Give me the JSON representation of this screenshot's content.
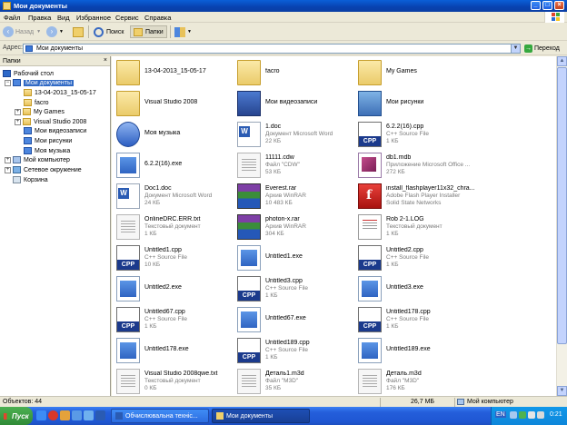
{
  "window": {
    "title": "Мои документы"
  },
  "menu": [
    "Файл",
    "Правка",
    "Вид",
    "Избранное",
    "Сервис",
    "Справка"
  ],
  "toolbar": {
    "back": "Назад",
    "search": "Поиск",
    "folders": "Папки"
  },
  "address": {
    "label": "Адрес:",
    "value": "Мои документы",
    "go": "Переход"
  },
  "folders_pane": {
    "title": "Папки",
    "close": "×",
    "tree": [
      {
        "label": "Рабочий стол",
        "icon": "desktop-icon"
      },
      {
        "label": "Мои документы",
        "icon": "my-documents-icon"
      },
      {
        "label": "13-04-2013_15-05-17",
        "icon": "folder-icon"
      },
      {
        "label": "facro",
        "icon": "folder-icon"
      },
      {
        "label": "My Games",
        "icon": "folder-icon"
      },
      {
        "label": "Visual Studio 2008",
        "icon": "folder-icon"
      },
      {
        "label": "Мои видеозаписи",
        "icon": "video-folder-icon"
      },
      {
        "label": "Мои рисунки",
        "icon": "pictures-folder-icon"
      },
      {
        "label": "Моя музыка",
        "icon": "music-folder-icon"
      },
      {
        "label": "Мой компьютер",
        "icon": "computer-icon"
      },
      {
        "label": "Сетевое окружение",
        "icon": "network-icon"
      },
      {
        "label": "Корзина",
        "icon": "recycle-bin-icon"
      }
    ]
  },
  "files": [
    {
      "name": "13-04-2013_15-05-17",
      "line2": "",
      "line3": "",
      "icon": "folder"
    },
    {
      "name": "facro",
      "line2": "",
      "line3": "",
      "icon": "folder"
    },
    {
      "name": "My Games",
      "line2": "",
      "line3": "",
      "icon": "folder"
    },
    {
      "name": "Visual Studio 2008",
      "line2": "",
      "line3": "",
      "icon": "folder"
    },
    {
      "name": "Мои видеозаписи",
      "line2": "",
      "line3": "",
      "icon": "video"
    },
    {
      "name": "Мои рисунки",
      "line2": "",
      "line3": "",
      "icon": "pics"
    },
    {
      "name": "Моя музыка",
      "line2": "",
      "line3": "",
      "icon": "music"
    },
    {
      "name": "1.doc",
      "line2": "Документ Microsoft Word",
      "line3": "22 КБ",
      "icon": "doc"
    },
    {
      "name": "6.2.2(16).cpp",
      "line2": "C++ Source File",
      "line3": "1 КБ",
      "icon": "cpp"
    },
    {
      "name": "6.2.2(16).exe",
      "line2": "",
      "line3": "",
      "icon": "exe"
    },
    {
      "name": "11111.cdw",
      "line2": "Файл \"CDW\"",
      "line3": "53 КБ",
      "icon": "generic"
    },
    {
      "name": "db1.mdb",
      "line2": "Приложение Microsoft Office ...",
      "line3": "272 КБ",
      "icon": "mdb"
    },
    {
      "name": "Doc1.doc",
      "line2": "Документ Microsoft Word",
      "line3": "24 КБ",
      "icon": "doc"
    },
    {
      "name": "Everest.rar",
      "line2": "Архив WinRAR",
      "line3": "10 483 КБ",
      "icon": "rar"
    },
    {
      "name": "install_flashplayer11x32_chra...",
      "line2": "Adobe Flash Player Installer",
      "line3": "Solid State Networks",
      "icon": "flash"
    },
    {
      "name": "OnlineDRC.ERR.txt",
      "line2": "Текстовый документ",
      "line3": "1 КБ",
      "icon": "generic"
    },
    {
      "name": "photon-x.rar",
      "line2": "Архив WinRAR",
      "line3": "304 КБ",
      "icon": "rar"
    },
    {
      "name": "Rob 2-1.LOG",
      "line2": "Текстовый документ",
      "line3": "1 КБ",
      "icon": "log"
    },
    {
      "name": "Untitled1.cpp",
      "line2": "C++ Source File",
      "line3": "10 КБ",
      "icon": "cpp"
    },
    {
      "name": "Untitled1.exe",
      "line2": "",
      "line3": "",
      "icon": "exe"
    },
    {
      "name": "Untitled2.cpp",
      "line2": "C++ Source File",
      "line3": "1 КБ",
      "icon": "cpp"
    },
    {
      "name": "Untitled2.exe",
      "line2": "",
      "line3": "",
      "icon": "exe"
    },
    {
      "name": "Untitled3.cpp",
      "line2": "C++ Source File",
      "line3": "1 КБ",
      "icon": "cpp"
    },
    {
      "name": "Untitled3.exe",
      "line2": "",
      "line3": "",
      "icon": "exe"
    },
    {
      "name": "Untitled67.cpp",
      "line2": "C++ Source File",
      "line3": "1 КБ",
      "icon": "cpp"
    },
    {
      "name": "Untitled67.exe",
      "line2": "",
      "line3": "",
      "icon": "exe"
    },
    {
      "name": "Untitled178.cpp",
      "line2": "C++ Source File",
      "line3": "1 КБ",
      "icon": "cpp"
    },
    {
      "name": "Untitled178.exe",
      "line2": "",
      "line3": "",
      "icon": "exe"
    },
    {
      "name": "Untitled189.cpp",
      "line2": "C++ Source File",
      "line3": "1 КБ",
      "icon": "cpp"
    },
    {
      "name": "Untitled189.exe",
      "line2": "",
      "line3": "",
      "icon": "exe"
    },
    {
      "name": "Visual Studio 2008qwe.txt",
      "line2": "Текстовый документ",
      "line3": "0 КБ",
      "icon": "generic"
    },
    {
      "name": "Деталь1.m3d",
      "line2": "Файл \"M3D\"",
      "line3": "35 КБ",
      "icon": "generic"
    },
    {
      "name": "Деталь.m3d",
      "line2": "Файл \"M3D\"",
      "line3": "176 КБ",
      "icon": "generic"
    }
  ],
  "status": {
    "objects": "Объектов: 44",
    "size": "26,7 МБ",
    "location": "Мой компьютер"
  },
  "taskbar": {
    "start": "Пуск",
    "tasks": [
      "Обчислювальна техніс...",
      "Мои документы"
    ],
    "lang": "EN",
    "clock": "0:21"
  }
}
